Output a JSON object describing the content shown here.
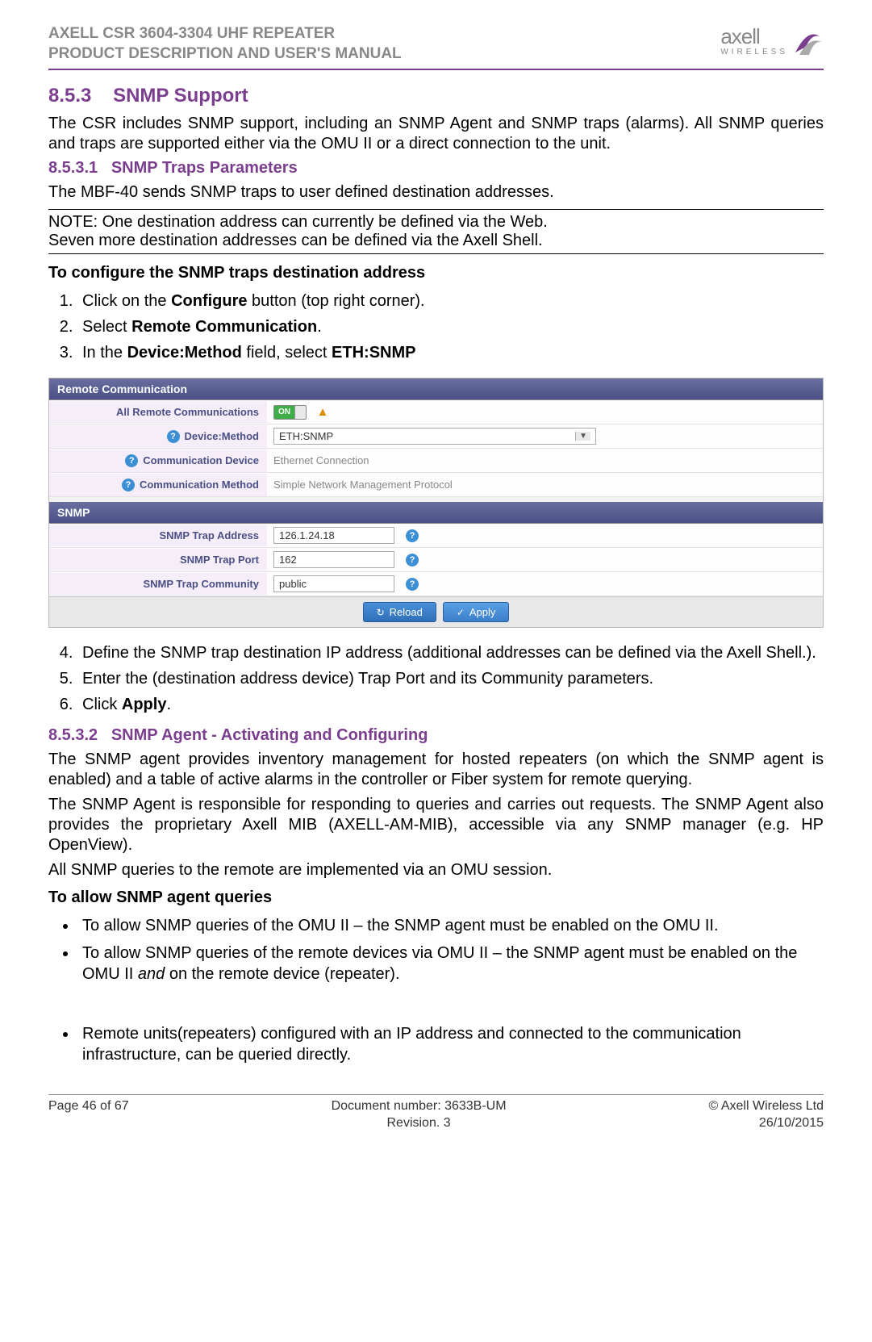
{
  "header": {
    "line1": "AXELL CSR 3604-3304 UHF REPEATER",
    "line2": "PRODUCT DESCRIPTION AND USER'S MANUAL",
    "logo_text1": "axell",
    "logo_text2": "WIRELESS"
  },
  "section": {
    "num": "8.5.3",
    "title": "SNMP Support",
    "intro": "The CSR includes SNMP support, including an SNMP Agent and SNMP traps (alarms). All SNMP queries and traps are supported either via the OMU II or a direct connection to the unit."
  },
  "sub1": {
    "num": "8.5.3.1",
    "title": "SNMP Traps Parameters",
    "intro": "The MBF-40 sends SNMP traps to user defined destination addresses.",
    "note_line1": "NOTE: One destination address can currently be defined via the Web.",
    "note_line2": "Seven more destination addresses can be defined via the Axell Shell.",
    "subhead": "To configure the SNMP traps destination address",
    "steps_pre": [
      "Click on the <b>Configure</b> button (top right corner).",
      "Select <b>Remote Communication</b>.",
      "In the <b>Device:Method</b> field, select <b>ETH:SNMP</b>"
    ],
    "steps_post": [
      "Define the SNMP trap destination IP address (additional addresses can be defined via the Axell Shell.).",
      "Enter the (destination address device) Trap Port and its Community parameters.",
      "Click <b>Apply</b>."
    ]
  },
  "panel": {
    "section1_title": "Remote Communication",
    "rows1": {
      "all_remote": {
        "label": "All Remote Communications",
        "toggle": "ON"
      },
      "device_method": {
        "label": "Device:Method",
        "value": "ETH:SNMP"
      },
      "comm_device": {
        "label": "Communication Device",
        "value": "Ethernet Connection"
      },
      "comm_method": {
        "label": "Communication Method",
        "value": "Simple Network Management Protocol"
      }
    },
    "section2_title": "SNMP",
    "rows2": {
      "trap_addr": {
        "label": "SNMP Trap Address",
        "value": "126.1.24.18"
      },
      "trap_port": {
        "label": "SNMP Trap Port",
        "value": "162"
      },
      "trap_comm": {
        "label": "SNMP Trap Community",
        "value": "public"
      }
    },
    "buttons": {
      "reload": "Reload",
      "apply": "Apply"
    }
  },
  "sub2": {
    "num": "8.5.3.2",
    "title": "SNMP Agent - Activating and Configuring",
    "para1": "The SNMP agent provides inventory management for hosted repeaters (on which the SNMP agent is enabled) and a table of active alarms in the controller or Fiber system for remote querying.",
    "para2": "The SNMP Agent is responsible for responding to queries and carries out requests. The SNMP Agent also provides the proprietary Axell MIB (AXELL-AM-MIB), accessible via any SNMP manager (e.g. HP OpenView).",
    "para3": "All SNMP queries to the remote are implemented via an OMU session.",
    "subhead": "To allow SNMP agent queries",
    "bullets_a": [
      "To allow SNMP queries of the OMU II – the SNMP agent must be enabled on the OMU II.",
      "To allow SNMP queries of the remote devices via OMU II – the SNMP agent must be enabled on the OMU II <i>and</i> on the remote device (repeater)."
    ],
    "bullets_b": [
      "Remote units(repeaters)  configured with an IP address and connected to the communication infrastructure, can be queried directly."
    ]
  },
  "footer": {
    "page": "Page 46 of 67",
    "docnum": "Document number: 3633B-UM",
    "revision": "Revision. 3",
    "copyright": "© Axell Wireless Ltd",
    "date": "26/10/2015"
  }
}
